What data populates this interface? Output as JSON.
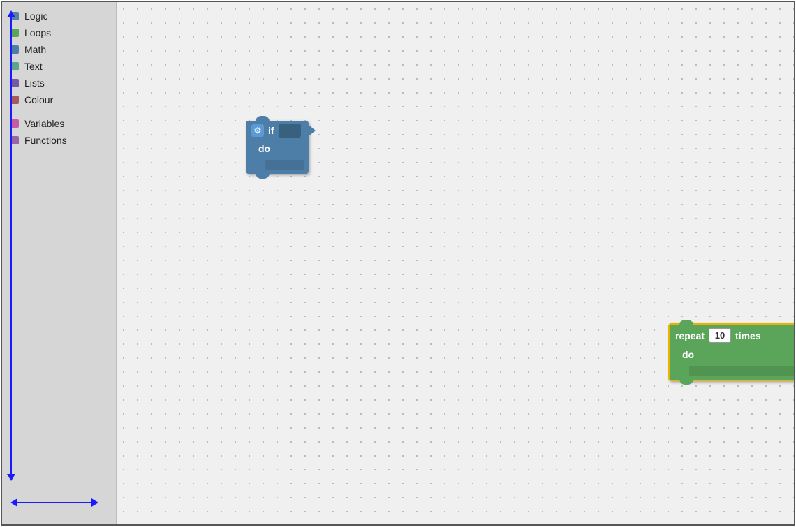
{
  "sidebar": {
    "items": [
      {
        "label": "Logic",
        "color": "#5b80a5",
        "id": "logic"
      },
      {
        "label": "Loops",
        "color": "#5ba55b",
        "id": "loops"
      },
      {
        "label": "Math",
        "color": "#4d7ea8",
        "id": "math"
      },
      {
        "label": "Text",
        "color": "#5ba58c",
        "id": "text"
      },
      {
        "label": "Lists",
        "color": "#745ba5",
        "id": "lists"
      },
      {
        "label": "Colour",
        "color": "#a55b5b",
        "id": "colour"
      }
    ],
    "divider_items": [
      {
        "label": "Variables",
        "color": "#c75ba5",
        "id": "variables"
      },
      {
        "label": "Functions",
        "color": "#9966a5",
        "id": "functions"
      }
    ]
  },
  "blocks": {
    "if_block": {
      "if_label": "if",
      "do_label": "do",
      "gear_icon": "⚙"
    },
    "repeat_block": {
      "repeat_label": "repeat",
      "times_label": "times",
      "do_label": "do",
      "count_value": "10"
    }
  }
}
